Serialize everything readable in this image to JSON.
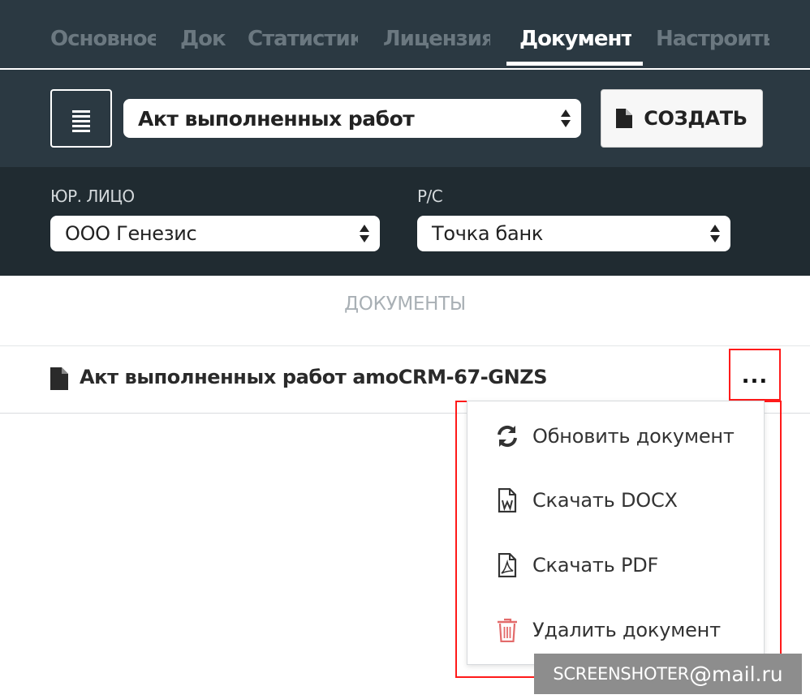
{
  "tabs": [
    {
      "label": "Основное",
      "active": false
    },
    {
      "label": "Док",
      "active": false
    },
    {
      "label": "Статистика",
      "active": false
    },
    {
      "label": "Лицензия",
      "active": false
    },
    {
      "label": "Документы",
      "active": true
    },
    {
      "label": "Настроить",
      "active": false
    }
  ],
  "toolbar": {
    "template_select": "Акт выполненных работ",
    "create_label": "СОЗДАТЬ"
  },
  "filters": {
    "legal_label": "ЮР. ЛИЦО",
    "legal_value": "ООО Генезис",
    "account_label": "Р/С",
    "account_value": "Точка банк"
  },
  "documents": {
    "section_title": "ДОКУМЕНТЫ",
    "items": [
      {
        "name": "Акт выполненных работ amoCRM-67-GNZS",
        "more": "..."
      }
    ]
  },
  "menu": {
    "items": [
      {
        "label": "Обновить документ",
        "icon": "refresh-icon"
      },
      {
        "label": "Скачать DOCX",
        "icon": "docx-file-icon"
      },
      {
        "label": "Скачать PDF",
        "icon": "pdf-file-icon"
      },
      {
        "label": "Удалить документ",
        "icon": "trash-icon"
      }
    ]
  },
  "watermark": {
    "part1": "SCREENSHOTER",
    "at": "@",
    "part2": "mail.ru"
  },
  "colors": {
    "header_bg": "#2b3942",
    "filter_bg": "#202b31",
    "highlight": "#ff1a1a",
    "delete_icon": "#e36b6b"
  }
}
